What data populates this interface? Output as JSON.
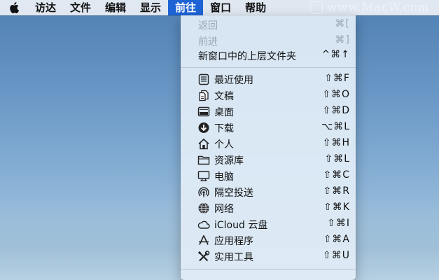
{
  "menubar": {
    "items": [
      "访达",
      "文件",
      "编辑",
      "显示",
      "前往",
      "窗口",
      "帮助"
    ],
    "active_index": 4
  },
  "watermark": "www.MacW.com",
  "menu": {
    "top_items": [
      {
        "label": "返回",
        "shortcut": "⌘[",
        "disabled": true
      },
      {
        "label": "前进",
        "shortcut": "⌘]",
        "disabled": true
      },
      {
        "label": "新窗口中的上层文件夹",
        "shortcut": "^⌘↑",
        "disabled": false
      }
    ],
    "places": [
      {
        "label": "最近使用",
        "shortcut": "⇧⌘F",
        "icon": "recents-icon"
      },
      {
        "label": "文稿",
        "shortcut": "⇧⌘O",
        "icon": "documents-icon"
      },
      {
        "label": "桌面",
        "shortcut": "⇧⌘D",
        "icon": "desktop-icon"
      },
      {
        "label": "下载",
        "shortcut": "⌥⌘L",
        "icon": "downloads-icon"
      },
      {
        "label": "个人",
        "shortcut": "⇧⌘H",
        "icon": "home-icon"
      },
      {
        "label": "资源库",
        "shortcut": "⇧⌘L",
        "icon": "folder-icon"
      },
      {
        "label": "电脑",
        "shortcut": "⇧⌘C",
        "icon": "computer-icon"
      },
      {
        "label": "隔空投送",
        "shortcut": "⇧⌘R",
        "icon": "airdrop-icon"
      },
      {
        "label": "网络",
        "shortcut": "⇧⌘K",
        "icon": "network-icon"
      },
      {
        "label": "iCloud 云盘",
        "shortcut": "⇧⌘I",
        "icon": "icloud-icon"
      },
      {
        "label": "应用程序",
        "shortcut": "⇧⌘A",
        "icon": "applications-icon"
      },
      {
        "label": "实用工具",
        "shortcut": "⇧⌘U",
        "icon": "utilities-icon"
      }
    ]
  }
}
